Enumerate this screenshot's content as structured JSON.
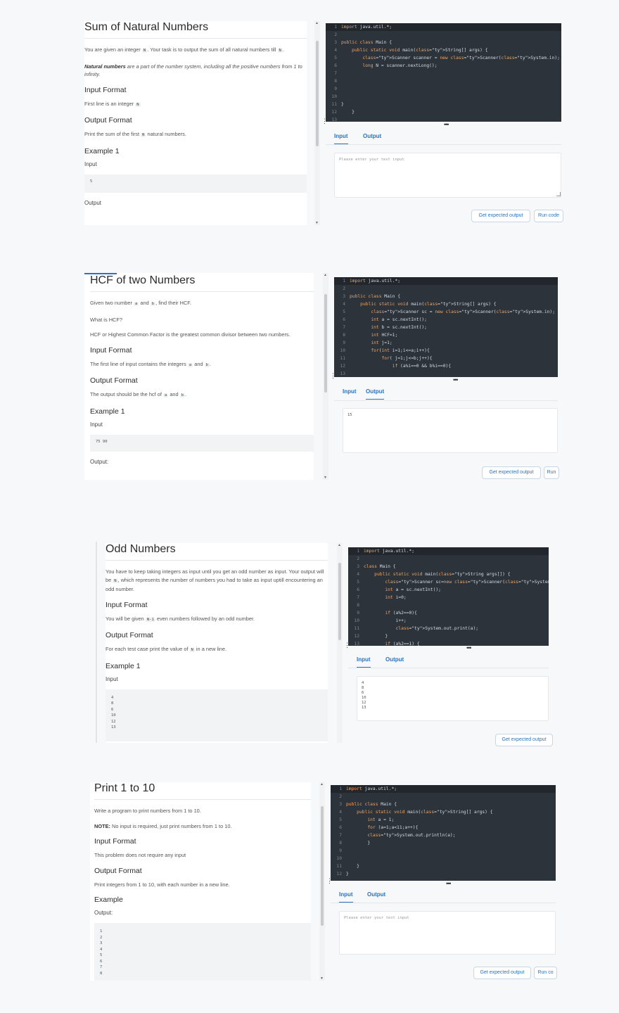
{
  "panels": [
    {
      "title": "Sum of Natural Numbers",
      "desc1_a": "You are given an integer ",
      "desc1_code": "N",
      "desc1_b": ". Your task is to output the sum of all natural numbers till ",
      "desc1_code2": "N",
      "desc1_c": ".",
      "desc2_bold": "Natural numbers",
      "desc2": " are a part of the number system, including all the positive numbers from 1 to infinity.",
      "input_format_title": "Input Format",
      "input_format_a": "First line is an integer ",
      "input_format_code": "N",
      "output_format_title": "Output Format",
      "output_format_a": "Print the sum of the first ",
      "output_format_code": "N",
      "output_format_b": " natural numbers.",
      "example_title": "Example 1",
      "input_label": "Input",
      "sample_input": "5",
      "output_label": "Output",
      "code": [
        {
          "n": "1",
          "t": "import java.util.*;"
        },
        {
          "n": "2",
          "t": ""
        },
        {
          "n": "3",
          "t": "public class Main {"
        },
        {
          "n": "4",
          "t": "    public static void main(String[] args) {"
        },
        {
          "n": "5",
          "t": "        Scanner scanner = new Scanner(System.in);"
        },
        {
          "n": "6",
          "t": "        long N = scanner.nextLong();"
        },
        {
          "n": "7",
          "t": ""
        },
        {
          "n": "8",
          "t": ""
        },
        {
          "n": "9",
          "t": ""
        },
        {
          "n": "10",
          "t": ""
        },
        {
          "n": "11",
          "t": "}"
        },
        {
          "n": "12",
          "t": "    }"
        },
        {
          "n": "13",
          "t": ""
        }
      ],
      "tab_input": "Input",
      "tab_output": "Output",
      "active_tab": "Input",
      "textarea_placeholder": "Please enter your test input",
      "btn_expected": "Get expected output",
      "btn_run": "Run code"
    },
    {
      "title": "HCF of two Numbers",
      "desc1_a": "Given two number ",
      "desc1_code": "a",
      "desc1_b": " and ",
      "desc1_code2": "b",
      "desc1_c": ", find their HCF.",
      "desc2": "What is HCF?",
      "desc3": "HCF or Highest Common Factor is the greatest common divisor between two numbers.",
      "input_format_title": "Input Format",
      "input_format_a": "The first line of input contains the integers ",
      "input_format_code": "a",
      "input_format_b": " and ",
      "input_format_code2": "b",
      "input_format_c": ".",
      "output_format_title": "Output Format",
      "output_format_a": "The output should be the hcf of ",
      "output_format_code": "a",
      "output_format_b": " and ",
      "output_format_code2": "b",
      "output_format_c": ".",
      "example_title": "Example 1",
      "input_label": "Input",
      "sample_input": "75 90",
      "output_label": "Output:",
      "code": [
        {
          "n": "1",
          "t": "import java.util.*;"
        },
        {
          "n": "2",
          "t": ""
        },
        {
          "n": "3",
          "t": "public class Main {"
        },
        {
          "n": "4",
          "t": "    public static void main(String[] args) {"
        },
        {
          "n": "5",
          "t": "        Scanner sc = new Scanner(System.in);"
        },
        {
          "n": "6",
          "t": "        int a = sc.nextInt();"
        },
        {
          "n": "7",
          "t": "        int b = sc.nextInt();"
        },
        {
          "n": "8",
          "t": "        int HCF=1;"
        },
        {
          "n": "9",
          "t": "        int j=1;"
        },
        {
          "n": "10",
          "t": "        for(int i=1;i<=a;i++){"
        },
        {
          "n": "11",
          "t": "            for( j=1;j<=b;j++){"
        },
        {
          "n": "12",
          "t": "                if (a%i==0 && b%i==0){"
        },
        {
          "n": "13",
          "t": ""
        }
      ],
      "tab_input": "Input",
      "tab_output": "Output",
      "active_tab": "Output",
      "output_value": "15",
      "btn_expected": "Get expected output",
      "btn_run": "Run"
    },
    {
      "title": "Odd Numbers",
      "desc1": "You have to keep taking integers as input until you get an odd number as input. Your output will be ",
      "desc1_code": "N",
      "desc1_b": ", which represents the number of numbers you had to take as input uptill encountering an odd number.",
      "input_format_title": "Input Format",
      "input_format_a": "You will be given ",
      "input_format_code": "N-1",
      "input_format_b": " even numbers followed by an odd number.",
      "output_format_title": "Output Format",
      "output_format_a": "For each test case print the value of ",
      "output_format_code": "N",
      "output_format_b": " in a new line.",
      "example_title": "Example 1",
      "input_label": "Input",
      "sample_input": "4\n8\n6\n10\n12\n13",
      "code": [
        {
          "n": "1",
          "t": "import java.util.*;"
        },
        {
          "n": "2",
          "t": ""
        },
        {
          "n": "3",
          "t": "class Main {"
        },
        {
          "n": "4",
          "t": "    public static void main(String args[]) {"
        },
        {
          "n": "5",
          "t": "        Scanner sc=new Scanner(System.in);"
        },
        {
          "n": "6",
          "t": "        int a = sc.nextInt();"
        },
        {
          "n": "7",
          "t": "        int i=0;"
        },
        {
          "n": "8",
          "t": ""
        },
        {
          "n": "9",
          "t": "        if (a%2==0){"
        },
        {
          "n": "10",
          "t": "            i++;"
        },
        {
          "n": "11",
          "t": "            System.out.print(a);"
        },
        {
          "n": "12",
          "t": "        }"
        },
        {
          "n": "13",
          "t": "        if (a%2==1) {"
        }
      ],
      "tab_input": "Input",
      "tab_output": "Output",
      "active_tab": "Input",
      "input_value": "4\n8\n6\n10\n12\n13",
      "btn_expected": "Get expected output"
    },
    {
      "title": "Print 1 to 10",
      "desc1": "Write a program to print numbers from 1 to 10.",
      "desc2_bold": "NOTE:",
      "desc2": " No input is required, just print numbers from 1 to 10.",
      "input_format_title": "Input Format",
      "input_format_a": "This problem does not require any input",
      "output_format_title": "Output Format",
      "output_format_a": "Print integers from 1 to 10, with each number in a new line.",
      "example_title": "Example",
      "output_label": "Output:",
      "sample_output": "1\n2\n3\n4\n5\n6\n7\n8",
      "code": [
        {
          "n": "1",
          "t": "import java.util.*;"
        },
        {
          "n": "2",
          "t": ""
        },
        {
          "n": "3",
          "t": "public class Main {"
        },
        {
          "n": "4",
          "t": "    public static void main(String[] args) {"
        },
        {
          "n": "5",
          "t": "        int a = 1;"
        },
        {
          "n": "6",
          "t": "        for (a=1;a<11;a++){"
        },
        {
          "n": "7",
          "t": "        System.out.println(a);"
        },
        {
          "n": "8",
          "t": "        }"
        },
        {
          "n": "9",
          "t": ""
        },
        {
          "n": "10",
          "t": ""
        },
        {
          "n": "11",
          "t": "    }"
        },
        {
          "n": "12",
          "t": "}"
        }
      ],
      "tab_input": "Input",
      "tab_output": "Output",
      "active_tab": "Input",
      "textarea_placeholder": "Please enter your test input",
      "btn_expected": "Get expected output",
      "btn_run": "Run co"
    }
  ],
  "colors": {
    "accent": "#2b73c0",
    "editor_bg": "#2d333b",
    "keyword": "#f0a35e",
    "type": "#6cb6ff"
  }
}
